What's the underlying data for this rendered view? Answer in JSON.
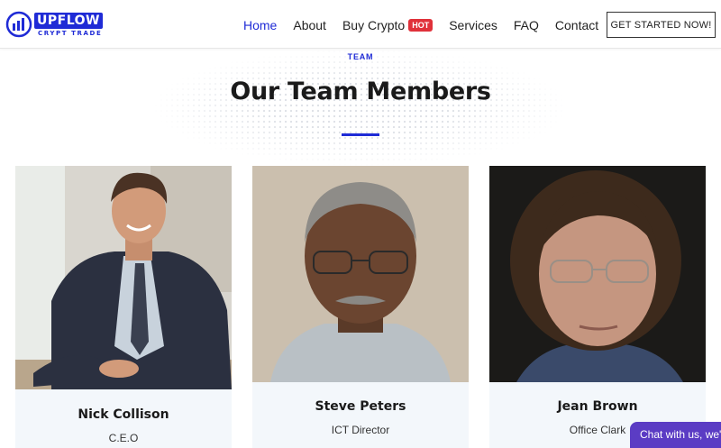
{
  "header": {
    "logo_text": "UPFLOW",
    "logo_sub": "CRYPT TRADE",
    "nav": [
      {
        "label": "Home",
        "active": true
      },
      {
        "label": "About"
      },
      {
        "label": "Buy Crypto",
        "badge": "HOT"
      },
      {
        "label": "Services"
      },
      {
        "label": "FAQ"
      },
      {
        "label": "Contact"
      }
    ],
    "cta": "GET STARTED NOW!"
  },
  "section": {
    "eyebrow": "TEAM",
    "title": "Our Team Members"
  },
  "team": [
    {
      "name": "Nick Collison",
      "role": "C.E.O"
    },
    {
      "name": "Steve Peters",
      "role": "ICT Director"
    },
    {
      "name": "Jean Brown",
      "role": "Office Clark"
    }
  ],
  "chat": {
    "label": "Chat with us, we're"
  },
  "colors": {
    "accent": "#1f2bd6",
    "hot_badge": "#e0313a",
    "chat": "#5b3cc4",
    "card_bg": "#f3f7fb"
  }
}
